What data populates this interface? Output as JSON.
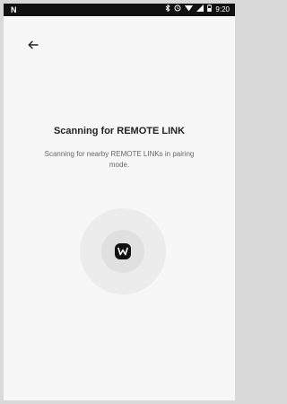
{
  "status_bar": {
    "left_text": "N",
    "time": "9:20",
    "icons": [
      "bluetooth-icon",
      "alarm-icon",
      "wifi-icon",
      "signal-icon",
      "battery-icon"
    ]
  },
  "header": {
    "back_icon": "arrow-left-icon"
  },
  "main": {
    "title": "Scanning for REMOTE LINK",
    "subtitle": "Scanning for nearby REMOTE LINKs in pairing mode."
  },
  "scanner": {
    "logo": "logo-badge",
    "logo_letter": "W"
  },
  "colors": {
    "background": "#f7f7f7",
    "status_bar": "#111111",
    "title": "#222222",
    "subtitle": "#666666",
    "ring_outer": "#ececec",
    "ring_inner": "#e0e0e0"
  }
}
